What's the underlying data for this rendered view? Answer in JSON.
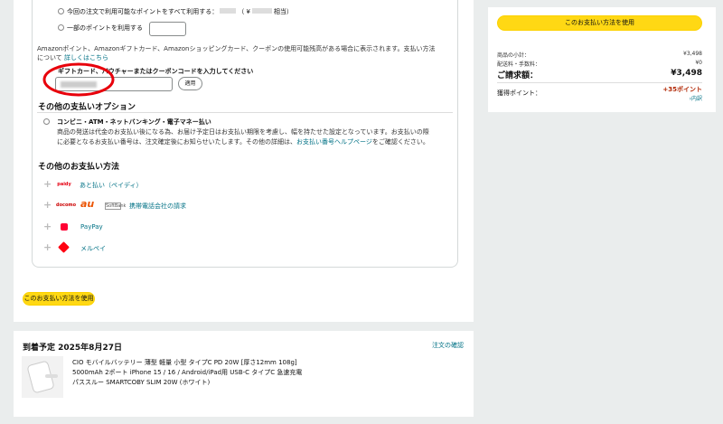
{
  "points": {
    "use_all_label": "今回の注文で利用可能なポイントをすべて利用する：",
    "use_all_value": "（ ¥",
    "use_all_suffix": "相当）",
    "use_partial_label": "一部のポイントを利用する"
  },
  "giftcard": {
    "notice": "Amazonポイント、Amazonギフトカード、Amazonショッピングカード、クーポンの使用可能残高がある場合に表示されます。支払い方法",
    "notice2_prefix": "について",
    "details_link": "詳しくはこちら",
    "input_label": "ギフトカード、バウチャーまたはクーポンコードを入力してください",
    "apply_label": "適用"
  },
  "other_options": {
    "heading": "その他の支払いオプション",
    "convenience_label": "コンビニ・ATM・ネットバンキング・電子マネー払い",
    "desc_line1": "商品の発送は代金のお支払い後になる為、お届け予定日はお支払い期限を考慮し、幅を持たせた設定となっています。お支払いの際",
    "desc_line2_prefix": "に必要となるお支払い番号は、注文確定後にお知らせいたします。その他の詳細は、",
    "desc_link": "お支払い番号ヘルプページ",
    "desc_line2_suffix": "をご確認ください。"
  },
  "other_methods": {
    "heading": "その他のお支払い方法",
    "items": [
      {
        "label": "あと払い（ペイディ）",
        "logo": "paidy"
      },
      {
        "label": "携帯電話会社の請求",
        "logo": "docomo au SoftBank"
      },
      {
        "label": "PayPay",
        "logo": "paypay-icon"
      },
      {
        "label": "メルペイ",
        "logo": "merpay-icon"
      }
    ]
  },
  "use_method_button": "このお支払い方法を使用",
  "summary": {
    "button": "このお支払い方法を使用",
    "subtotal_label": "商品の小計：",
    "subtotal_value": "¥3,498",
    "shipping_label": "配送料・手数料：",
    "shipping_value": "¥0",
    "total_label": "ご請求額：",
    "total_value": "¥3,498",
    "points_label": "獲得ポイント：",
    "points_value": "+35ポイント",
    "points_link": "›内訳"
  },
  "delivery": {
    "title": "到着予定 2025年8月27日",
    "confirm_link": "注文の確認",
    "product_line1": "CIO モバイルバッテリー 薄型 軽量 小型 タイプC PD 20W [厚さ12mm 108g]",
    "product_line2": "5000mAh 2ポート iPhone 15 / 16 / Android/iPad用 USB-C タイプC 急速充電",
    "product_line3": "パススルー SMARTCOBY SLIM 20W (ホワイト)"
  },
  "colors": {
    "accent_yellow": "#ffd814",
    "link": "#007185",
    "points_red": "#b12704",
    "annotation_red": "#e8000b"
  }
}
